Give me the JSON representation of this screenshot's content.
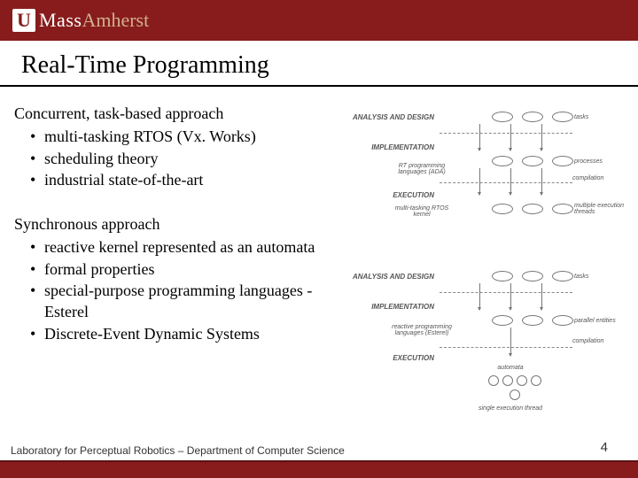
{
  "logo": {
    "u": "U",
    "mass": "Mass",
    "amherst": "Amherst"
  },
  "title": "Real-Time Programming",
  "section1": {
    "head": "Concurrent, task-based approach",
    "items": [
      "multi-tasking RTOS (Vx. Works)",
      "scheduling theory",
      "industrial state-of-the-art"
    ]
  },
  "section2": {
    "head": "Synchronous approach",
    "items": [
      "reactive kernel represented as an automata",
      "formal properties",
      "special-purpose programming languages - Esterel",
      "Discrete-Event Dynamic Systems"
    ]
  },
  "diag1": {
    "r1": "ANALYSIS AND DESIGN",
    "s1": "tasks",
    "r2": "IMPLEMENTATION",
    "s2": "processes",
    "sub2": "RT programming languages (ADA)",
    "r3": "EXECUTION",
    "s3a": "compilation",
    "sub3a": "multi-tasking RTOS kernel",
    "s3b": "multiple execution threads"
  },
  "diag2": {
    "r1": "ANALYSIS AND DESIGN",
    "s1": "tasks",
    "r2": "IMPLEMENTATION",
    "s2": "parallel entities",
    "sub2": "reactive programming languages (Esterel)",
    "r3": "EXECUTION",
    "s3a": "compilation",
    "sub3a": "automata",
    "sub3b": "single execution thread"
  },
  "footer": "Laboratory for Perceptual Robotics – Department of Computer Science",
  "page": "4"
}
